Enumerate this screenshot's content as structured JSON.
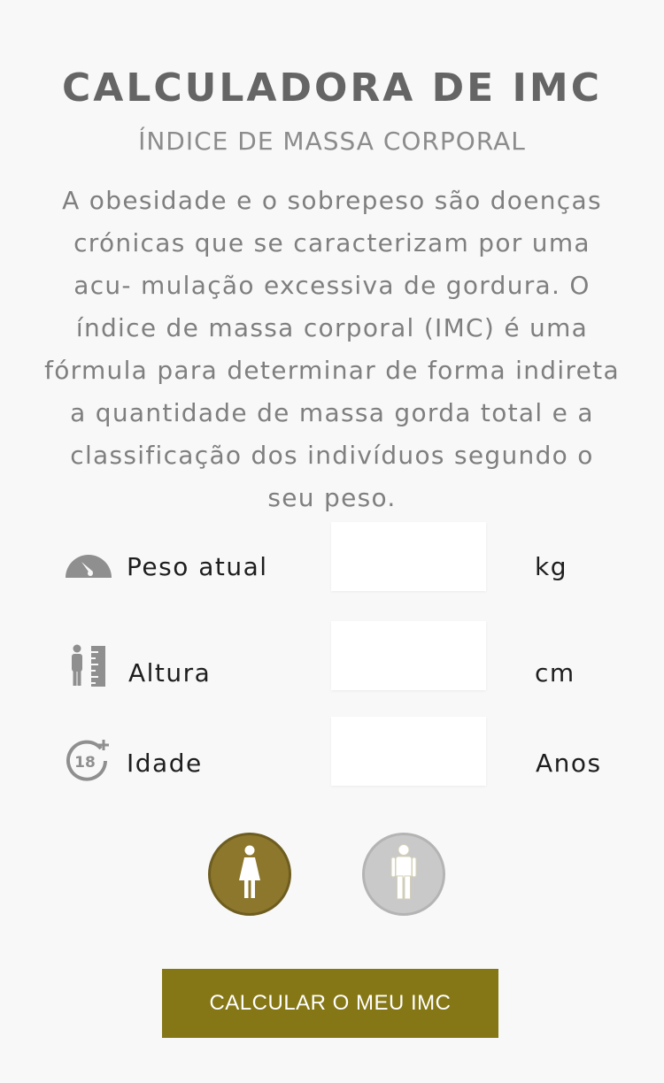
{
  "header": {
    "title": "CALCULADORA DE IMC",
    "subtitle": "ÍNDICE DE MASSA CORPORAL",
    "description": "A obesidade e o sobrepeso são doenças crónicas que se caracterizam por uma acu- mulação excessiva de gordura. O índice de massa corporal (IMC) é uma fórmula para determinar de forma indireta a quantidade de massa gorda total e a classificação dos indivíduos segundo o seu peso."
  },
  "form": {
    "weight": {
      "label": "Peso atual",
      "unit": "kg",
      "value": "",
      "icon": "scale-gauge-icon"
    },
    "height": {
      "label": "Altura",
      "unit": "cm",
      "value": "",
      "icon": "height-ruler-icon"
    },
    "age": {
      "label": "Idade",
      "unit": "Anos",
      "value": "",
      "icon": "age-18-plus-icon"
    }
  },
  "gender": {
    "selected": "female",
    "options": [
      {
        "id": "female",
        "icon": "female-figure-icon"
      },
      {
        "id": "male",
        "icon": "male-figure-icon"
      }
    ]
  },
  "actions": {
    "calculate_label": "CALCULAR O MEU IMC"
  },
  "colors": {
    "accent": "#857716",
    "female_selected": "#8c772c",
    "male_unselected": "#c9c9c9",
    "text_dark": "#1e1e1e",
    "text_muted": "#7f7f7f"
  }
}
